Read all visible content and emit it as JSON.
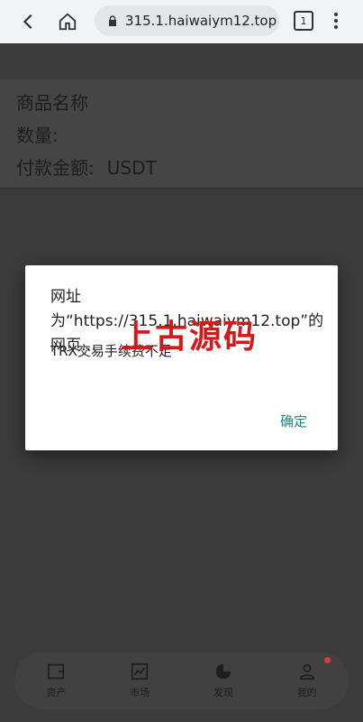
{
  "browser": {
    "url": "315.1.haiwaiym12.top",
    "tabs_count": "1"
  },
  "order": {
    "product_label": "商品名称",
    "quantity_label": "数量:",
    "payment_label": "付款金额:",
    "payment_currency": "USDT"
  },
  "dialog": {
    "title": "网址为“https://315.1.haiwaiym12.top”的网页…",
    "message": "TRX交易手续费不足",
    "ok_label": "确定"
  },
  "watermark": "上古源码",
  "bottom_nav": {
    "items": [
      {
        "label": "资产",
        "icon": "wallet-icon"
      },
      {
        "label": "市场",
        "icon": "chart-icon"
      },
      {
        "label": "发现",
        "icon": "discover-icon"
      },
      {
        "label": "我的",
        "icon": "user-icon"
      }
    ]
  },
  "colors": {
    "accent": "#1e8a7e",
    "badge": "#d43b3b",
    "watermark": "#d11a1a"
  }
}
